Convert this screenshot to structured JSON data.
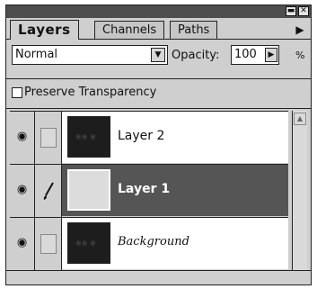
{
  "window": {
    "minimize_glyph": "▬",
    "close_glyph": "✕"
  },
  "tabs": [
    {
      "label": "Layers",
      "active": true
    },
    {
      "label": "Channels",
      "active": false
    },
    {
      "label": "Paths",
      "active": false
    }
  ],
  "tabs_menu_glyph": "▶",
  "blend_mode": {
    "value": "Normal",
    "arrow": "▼"
  },
  "opacity": {
    "label": "Opacity:",
    "value": "100",
    "arrow": "▶",
    "unit": "%"
  },
  "preserve_transparency": {
    "label": "Preserve Transparency",
    "checked": false
  },
  "layers": [
    {
      "name": "Layer 2",
      "visible": true,
      "selected": false,
      "thumb": "dark",
      "thumb_mark": "※※ ※",
      "brush": ""
    },
    {
      "name": "Layer 1",
      "visible": true,
      "selected": true,
      "thumb": "light",
      "thumb_mark": "",
      "brush": "𝒷"
    },
    {
      "name": "Background",
      "visible": true,
      "selected": false,
      "thumb": "dark",
      "thumb_mark": "※※ ※",
      "brush": ""
    }
  ],
  "eye_glyph": "◉",
  "scroll_up_glyph": "▲",
  "colors": {
    "panel": "#cfcfcf",
    "selected_row": "#555555",
    "titlebar": "#4e4e4e"
  }
}
